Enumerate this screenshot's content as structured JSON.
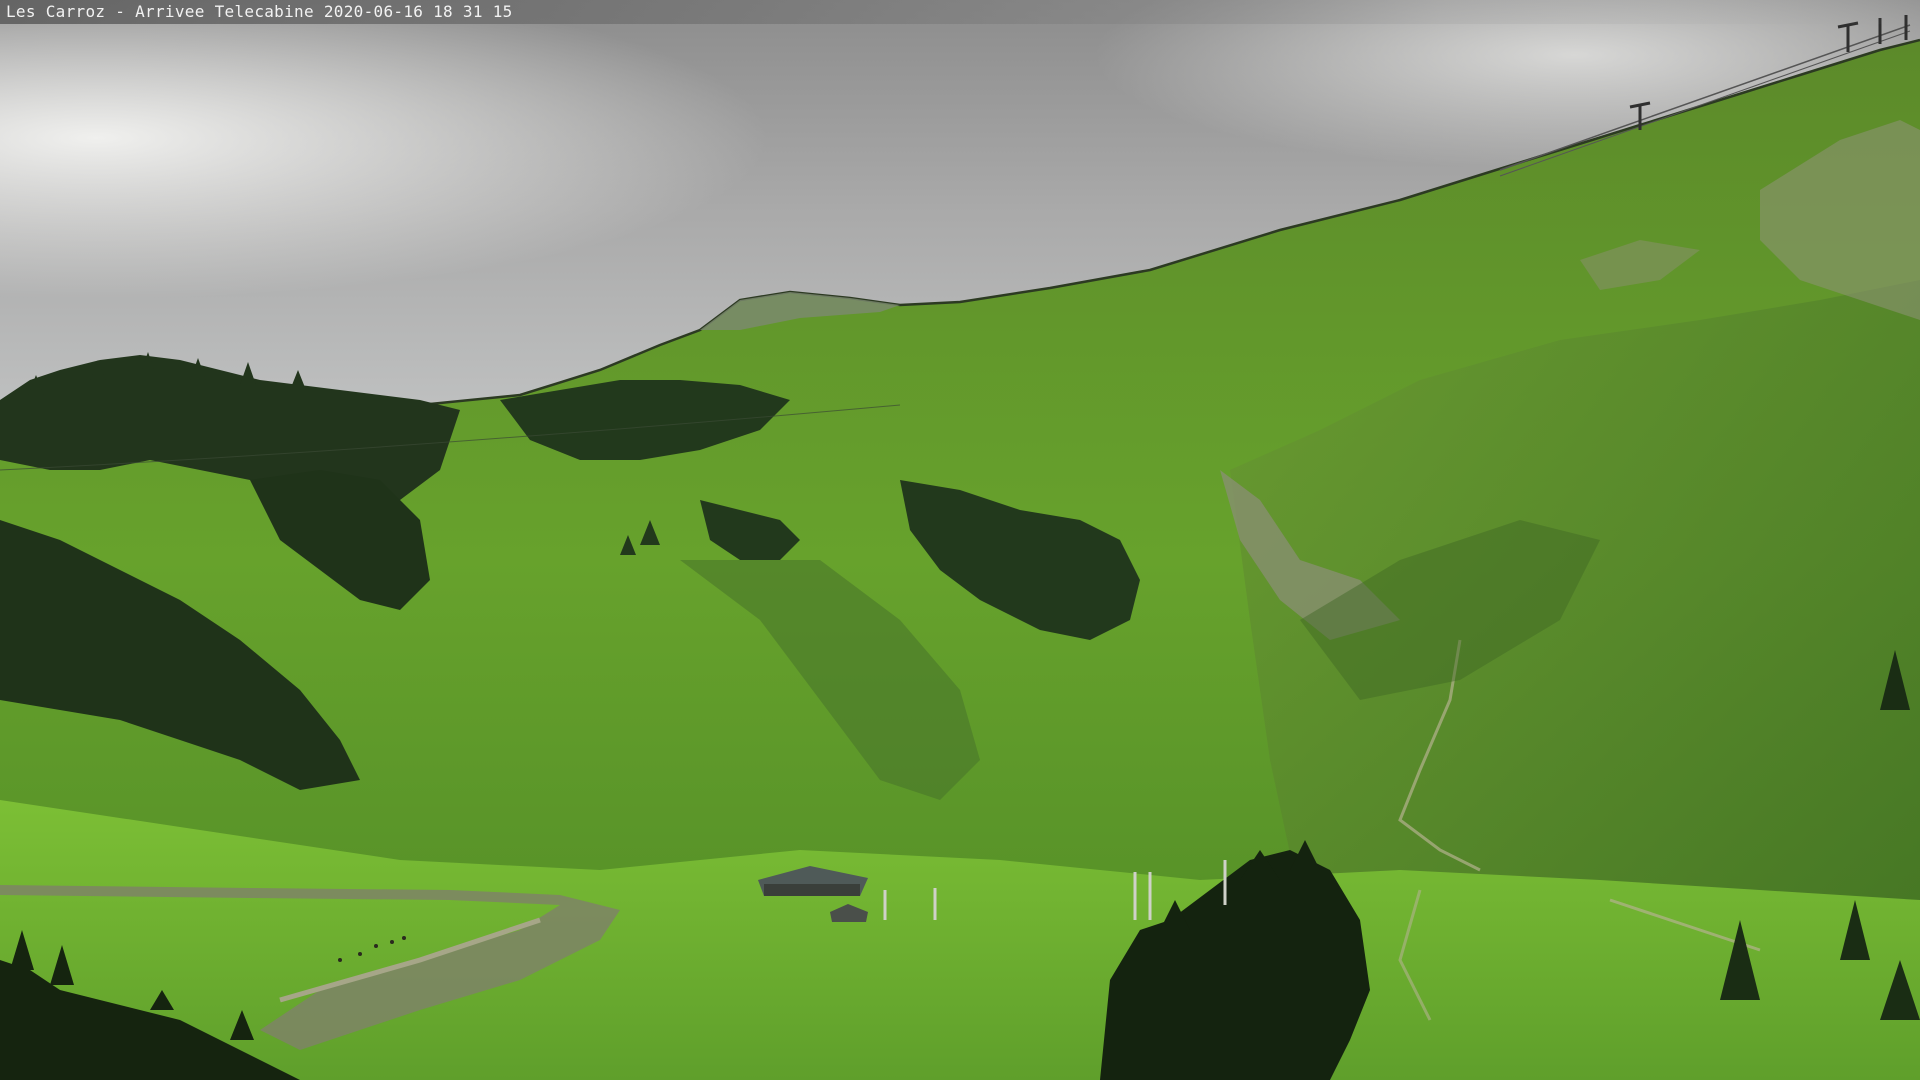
{
  "caption": {
    "location": "Les Carroz - Arrivee Telecabine",
    "date": "2020-06-16",
    "time": "18 31 15"
  }
}
